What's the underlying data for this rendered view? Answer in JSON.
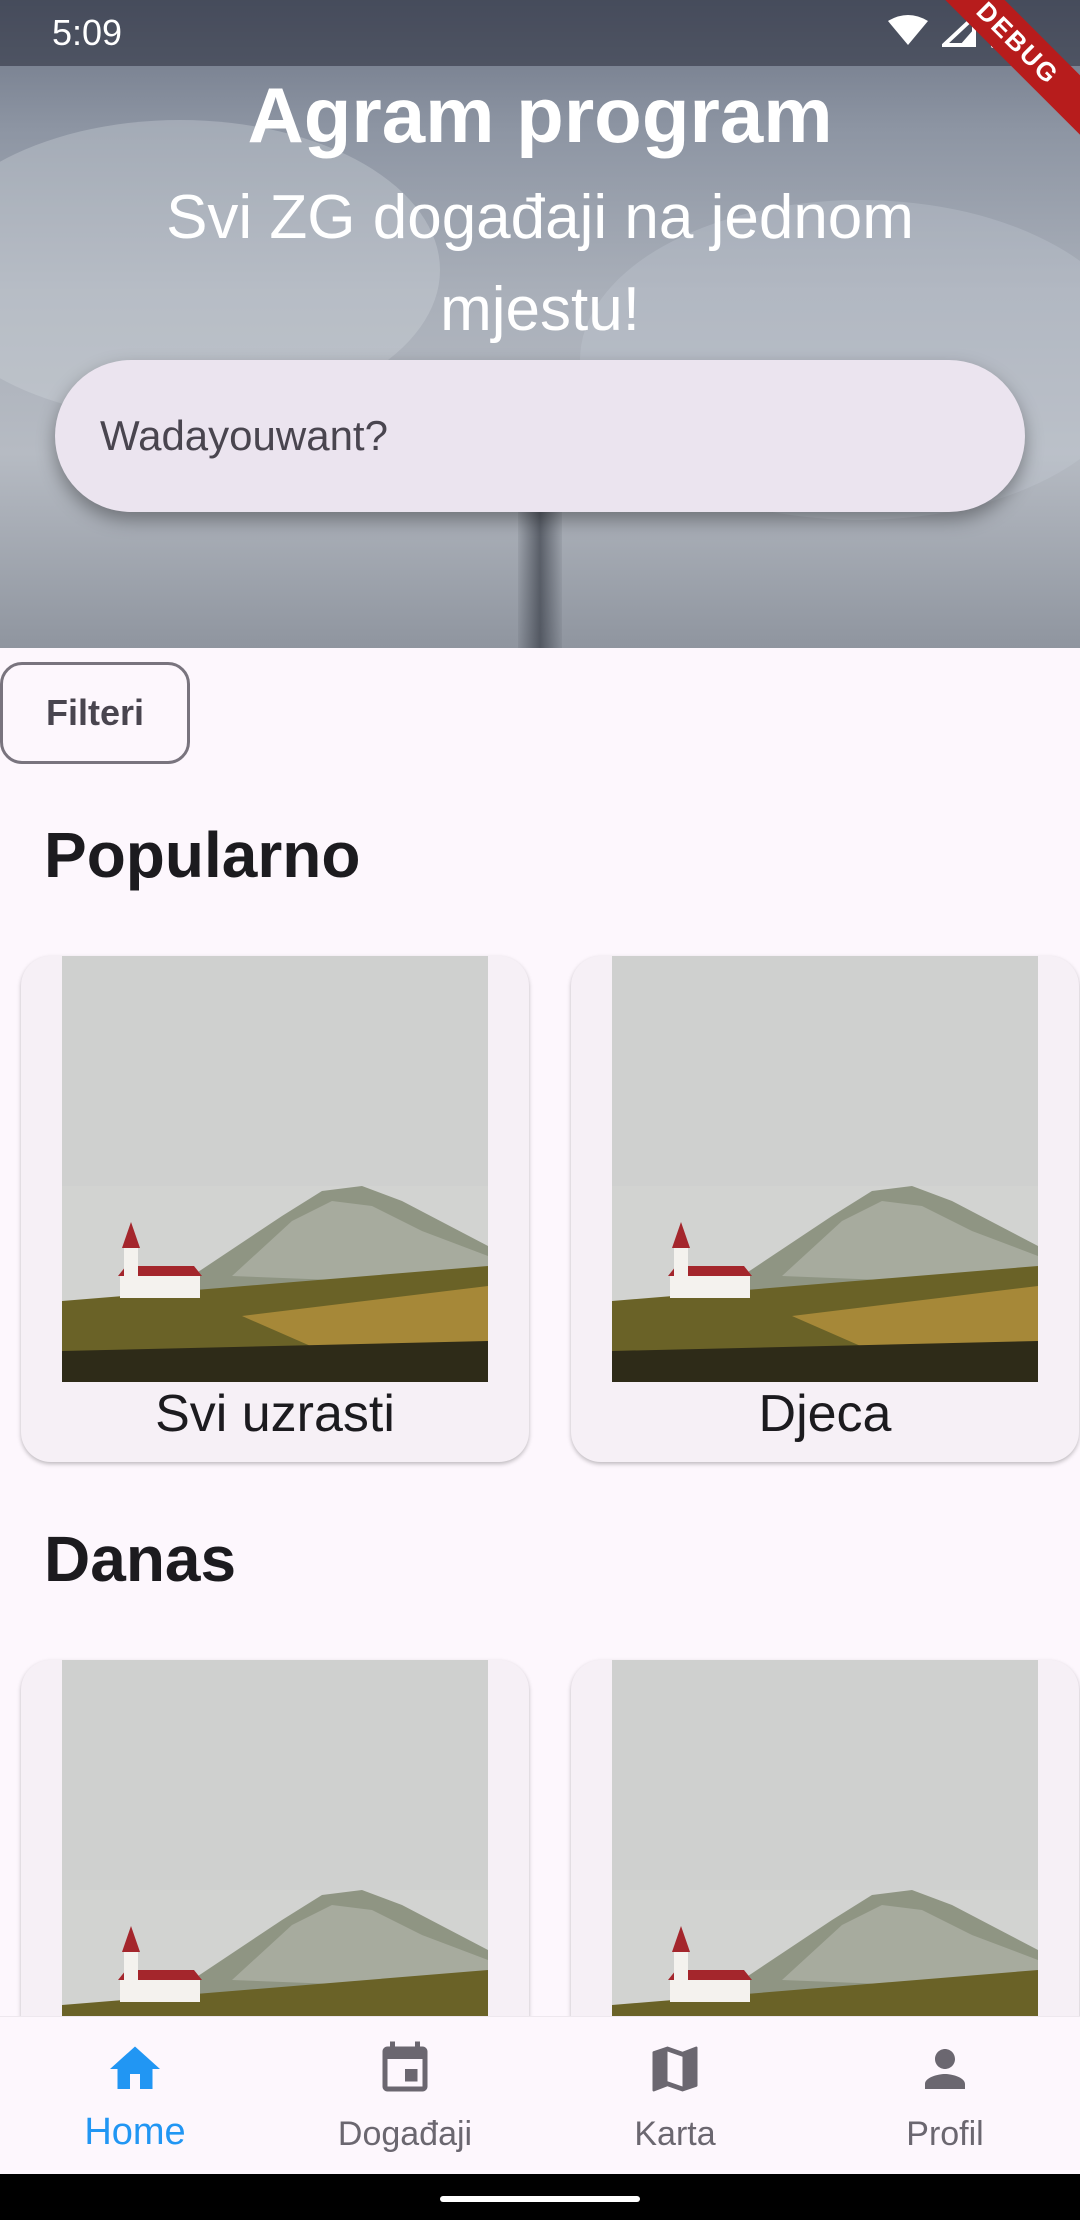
{
  "status_bar": {
    "time": "5:09",
    "icons": [
      "wifi-icon",
      "signal-icon",
      "battery-icon"
    ]
  },
  "debug_banner": "DEBUG",
  "hero": {
    "title": "Agram program",
    "subtitle": "Svi ZG događaji na jednom mjestu!"
  },
  "search": {
    "placeholder": "Wadayouwant?"
  },
  "filter_button": "Filteri",
  "sections": [
    {
      "title": "Popularno",
      "cards": [
        {
          "label": "Svi uzrasti"
        },
        {
          "label": "Djeca"
        }
      ]
    },
    {
      "title": "Danas",
      "cards": [
        {
          "label": ""
        },
        {
          "label": ""
        }
      ]
    }
  ],
  "bottom_nav": [
    {
      "label": "Home",
      "icon": "home-icon",
      "active": true
    },
    {
      "label": "Događaji",
      "icon": "calendar-icon",
      "active": false
    },
    {
      "label": "Karta",
      "icon": "map-icon",
      "active": false
    },
    {
      "label": "Profil",
      "icon": "person-icon",
      "active": false
    }
  ],
  "colors": {
    "accent": "#2196f3",
    "background": "#fdf7fd",
    "search_bg": "#ebe4ef",
    "debug": "#b71c1c"
  }
}
